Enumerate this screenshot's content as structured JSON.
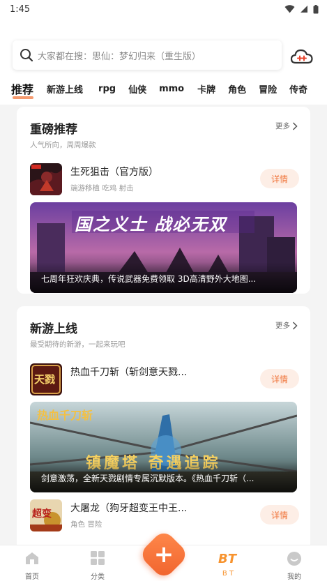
{
  "status": {
    "time": "1:45"
  },
  "search": {
    "placeholder": "大家都在搜：思仙：梦幻归来（重生版）"
  },
  "tabs": [
    "推荐",
    "新游上线",
    "rpg",
    "仙侠",
    "mmo",
    "卡牌",
    "角色",
    "冒险",
    "传奇"
  ],
  "sections": [
    {
      "title": "重磅推荐",
      "subtitle": "人气所向，周周爆款",
      "more": "更多",
      "games": [
        {
          "name": "生死狙击（官方版）",
          "tags": "端游移植 吃鸡 射击",
          "button": "详情"
        }
      ],
      "banner": {
        "caption": "七周年狂欢庆典，传说武器免费领取 3D高清野外大地图...",
        "art_text": "国之义士 战必无双"
      }
    },
    {
      "title": "新游上线",
      "subtitle": "最受期待的新游，一起来玩吧",
      "more": "更多",
      "games": [
        {
          "name": "热血千刀斩（斩剑意天戮...",
          "tags": "",
          "button": "详情",
          "icon_text": "天戮"
        },
        {
          "name": "大屠龙（狗牙超变王中王...",
          "tags": "角色 冒险",
          "button": "详情",
          "icon_text": "超变"
        }
      ],
      "banner": {
        "caption": "剑意激荡，全新天戮剧情专属沉默版本。《热血千刀斩（...",
        "art_title": "热血千刀斩",
        "art_text": "镇魔塔 奇遇追踪"
      }
    }
  ],
  "nav": [
    {
      "label": "首页"
    },
    {
      "label": "分类"
    },
    {
      "label": "B T"
    },
    {
      "label": "我的"
    }
  ],
  "colors": {
    "accent": "#f0743a",
    "bt_badge": "#f7932e"
  }
}
